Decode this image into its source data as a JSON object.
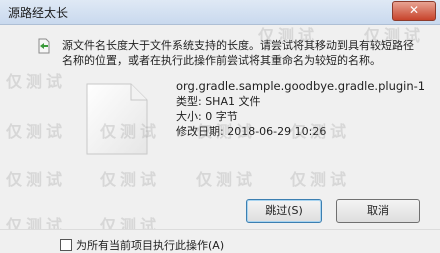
{
  "window": {
    "title": "源路经太长",
    "close_glyph": "✕"
  },
  "message": "源文件名长度大于文件系统支持的长度。请尝试将其移动到具有较短路径名称的位置，或者在执行此操作前尝试将其重命名为较短的名称。",
  "file": {
    "name": "org.gradle.sample.goodbye.gradle.plugin-1....",
    "type": "类型: SHA1 文件",
    "size": "大小: 0 字节",
    "modified": "修改日期: 2018-06-29 10:26"
  },
  "buttons": {
    "skip": "跳过(S)",
    "cancel": "取消"
  },
  "checkbox": {
    "label": "为所有当前项目执行此操作(A)",
    "checked": false
  },
  "watermark_text": "仅测试",
  "icons": {
    "warning": "warning-icon",
    "file": "file-icon"
  }
}
